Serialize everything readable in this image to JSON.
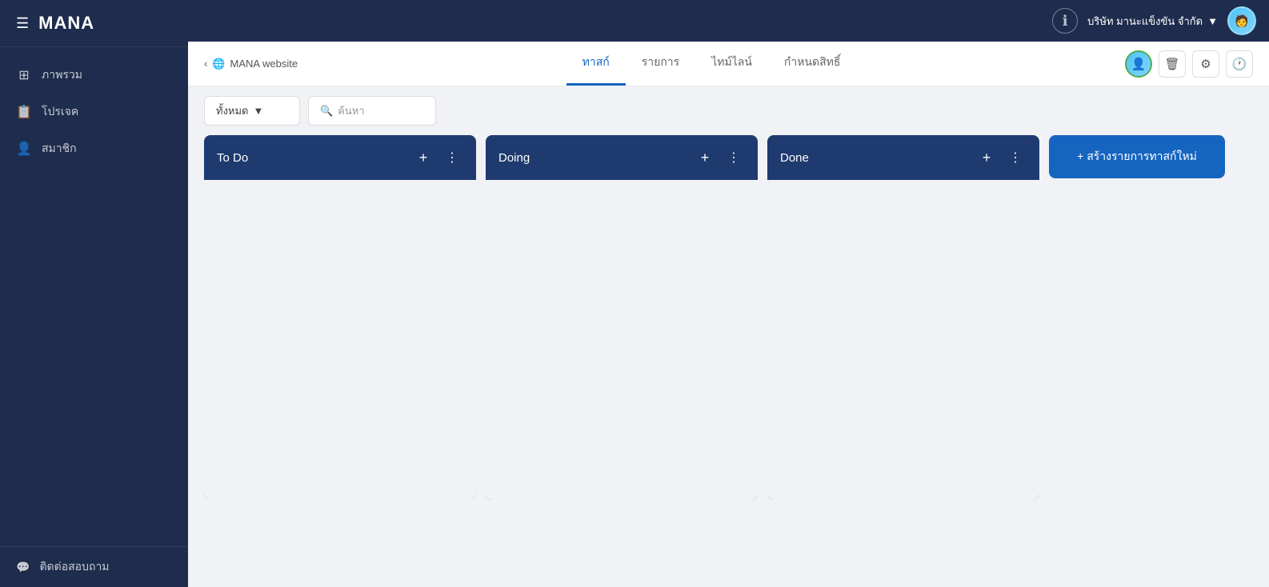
{
  "sidebar": {
    "logo": "MANA",
    "hamburger": "☰",
    "nav_items": [
      {
        "id": "overview",
        "icon": "⊞",
        "label": "ภาพรวม"
      },
      {
        "id": "project",
        "icon": "🗂",
        "label": "โปรเจค"
      },
      {
        "id": "member",
        "icon": "👤",
        "label": "สมาชิก"
      }
    ],
    "footer_item": {
      "icon": "💬",
      "label": "ติดต่อสอบถาม"
    }
  },
  "topbar": {
    "info_icon": "ℹ",
    "company_name": "บริษัท มานะแข็งขัน จำกัด",
    "chevron": "▼",
    "avatar_emoji": "🧑"
  },
  "sub_header": {
    "back_arrow": "‹",
    "globe_icon": "🌐",
    "project_name": "MANA website",
    "tabs": [
      {
        "id": "task",
        "label": "ทาสก์",
        "active": true
      },
      {
        "id": "list",
        "label": "รายการ",
        "active": false
      },
      {
        "id": "timeline",
        "label": "ไทม์ไลน์",
        "active": false
      },
      {
        "id": "rights",
        "label": "กำหนดสิทธิ์",
        "active": false
      }
    ],
    "action_icons": [
      "👤",
      "🗑",
      "⚙",
      "🕐"
    ]
  },
  "toolbar": {
    "filter_label": "ทั้งหมด",
    "filter_chevron": "▼",
    "search_placeholder": "ค้นหา",
    "search_icon": "🔍"
  },
  "kanban": {
    "columns": [
      {
        "id": "todo",
        "title": "To Do"
      },
      {
        "id": "doing",
        "title": "Doing"
      },
      {
        "id": "done",
        "title": "Done"
      }
    ],
    "create_btn_label": "+ สร้างรายการทาสก์ใหม่"
  }
}
